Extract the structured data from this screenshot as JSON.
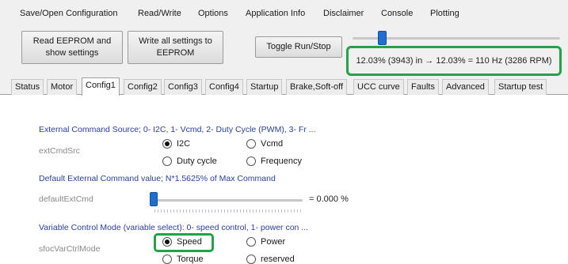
{
  "menu": [
    "Save/Open Configuration",
    "Read/Write",
    "Options",
    "Application Info",
    "Disclaimer",
    "Console",
    "Plotting"
  ],
  "toolbar": {
    "read_eeprom_line1": "Read EEPROM and",
    "read_eeprom_line2": "show settings",
    "write_eeprom_line1": "Write all settings to",
    "write_eeprom_line2": "EEPROM",
    "toggle_run_stop": "Toggle Run/Stop",
    "speed_readout": "12.03% (3943) in → 12.03% = 110 Hz (3286 RPM)",
    "speed_slider_value_percent": 12.03
  },
  "tabs": [
    "Status",
    "Motor",
    "Config1",
    "Config2",
    "Config3",
    "Config4",
    "Startup",
    "Brake,Soft-off",
    "UCC curve",
    "Faults",
    "Advanced",
    "Startup test"
  ],
  "active_tab": "Config1",
  "config1": {
    "ext_cmd_src": {
      "title": "External Command Source; 0- I2C, 1- Vcmd, 2- Duty Cycle (PWM), 3- Fr ...",
      "param": "extCmdSrc",
      "options": [
        "I2C",
        "Vcmd",
        "Duty cycle",
        "Frequency"
      ],
      "selected": "I2C"
    },
    "default_ext_cmd": {
      "title": "Default External Command value; N*1.5625% of Max Command",
      "param": "defaultExtCmd",
      "value_text": "= 0.000 %",
      "value_percent": 0
    },
    "var_ctrl_mode": {
      "title": "Variable Control Mode (variable select): 0- speed control, 1- power con ...",
      "param": "sfocVarCtrlMode",
      "options": [
        "Speed",
        "Power",
        "Torque",
        "reserved"
      ],
      "selected": "Speed"
    }
  },
  "colors": {
    "highlight": "#22a34a",
    "section_title": "#2a3f9b",
    "slider_thumb": "#1e6fd0"
  }
}
